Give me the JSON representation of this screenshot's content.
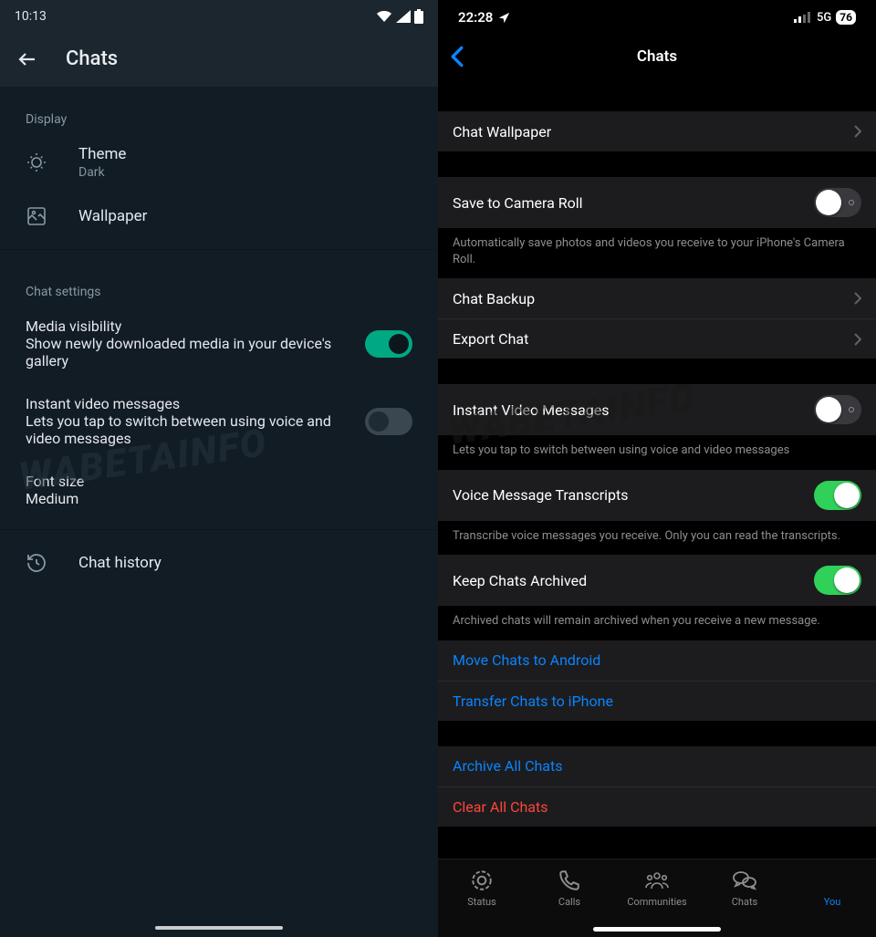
{
  "android": {
    "status": {
      "time": "10:13"
    },
    "header": {
      "title": "Chats"
    },
    "section_display": "Display",
    "theme": {
      "title": "Theme",
      "value": "Dark"
    },
    "wallpaper": {
      "title": "Wallpaper"
    },
    "section_chat": "Chat settings",
    "media_vis": {
      "title": "Media visibility",
      "sub": "Show newly downloaded media in your device's gallery",
      "on": true
    },
    "ivm": {
      "title": "Instant video messages",
      "sub": "Lets you tap to switch between using voice and video messages",
      "on": false
    },
    "font": {
      "title": "Font size",
      "value": "Medium"
    },
    "history": {
      "title": "Chat history"
    }
  },
  "ios": {
    "status": {
      "time": "22:28",
      "net": "5G",
      "battery": "76"
    },
    "header": {
      "title": "Chats"
    },
    "wallpaper": "Chat Wallpaper",
    "camera_roll": {
      "title": "Save to Camera Roll",
      "on": false,
      "foot": "Automatically save photos and videos you receive to your iPhone's Camera Roll."
    },
    "backup": "Chat Backup",
    "export": "Export Chat",
    "ivm": {
      "title": "Instant Video Messages",
      "on": false,
      "foot": "Lets you tap to switch between using voice and video messages"
    },
    "vmt": {
      "title": "Voice Message Transcripts",
      "on": true,
      "foot": "Transcribe voice messages you receive. Only you can read the transcripts."
    },
    "keep": {
      "title": "Keep Chats Archived",
      "on": true,
      "foot": "Archived chats will remain archived when you receive a new message."
    },
    "move_android": "Move Chats to Android",
    "transfer_iphone": "Transfer Chats to iPhone",
    "archive_all": "Archive All Chats",
    "clear_all": "Clear All Chats",
    "tabs": {
      "status": "Status",
      "calls": "Calls",
      "communities": "Communities",
      "chats": "Chats",
      "you": "You"
    }
  },
  "watermark": "WABETAINFO"
}
